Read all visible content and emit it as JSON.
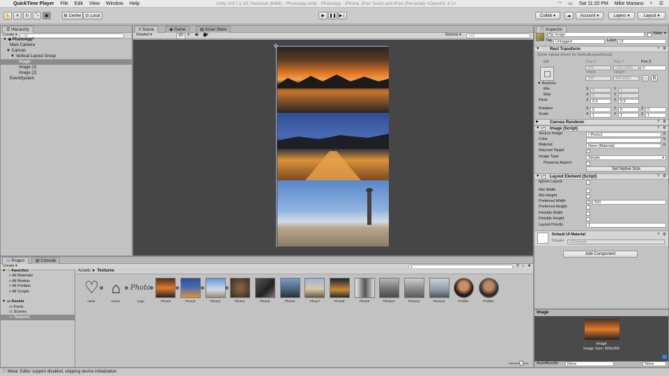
{
  "menubar": {
    "app": "QuickTime Player",
    "items": [
      "File",
      "Edit",
      "View",
      "Window",
      "Help"
    ],
    "window_title": "Unity 2017.1.1f1 Personal (64bit) - PhotoApp.unity - PhotoApp - iPhone, iPod Touch and iPad (Personal) <OpenGL 4.1>",
    "clock": "Sat 11:20 PM",
    "user": "Mike Mariano"
  },
  "toolbar": {
    "center": "Center",
    "local": "Local",
    "collab": "Collab",
    "account": "Account",
    "layers": "Layers",
    "layout": "Layout"
  },
  "hierarchy": {
    "tab": "Hierarchy",
    "create": "Create",
    "search_placeholder": "All",
    "items": [
      {
        "label": "PhotoApp*"
      },
      {
        "label": "Main Camera"
      },
      {
        "label": "Canvas"
      },
      {
        "label": "Vertical Layout Group"
      },
      {
        "label": "Image"
      },
      {
        "label": "Image (1)"
      },
      {
        "label": "Image (2)"
      },
      {
        "label": "EventSystem"
      }
    ]
  },
  "scene": {
    "tabs": [
      "Scene",
      "Game",
      "Asset Store"
    ],
    "shading": "Shaded",
    "mode_2d": "2D",
    "gizmos": "Gizmos",
    "search_placeholder": "All"
  },
  "inspector": {
    "tab": "Inspector",
    "object_name": "Image",
    "static_label": "Static",
    "tag_label": "Tag",
    "tag_value": "Untagged",
    "layer_label": "Layer",
    "layer_value": "UI",
    "rect_transform": {
      "title": "Rect Transform",
      "note": "Some values driven by VerticalLayoutGroup.",
      "anchor_preset": "left",
      "pos_x_label": "Pos X",
      "pos_x": "375",
      "pos_y_label": "Pos Y",
      "pos_y": "-222.3333",
      "pos_z_label": "Pos Z",
      "pos_z": "0",
      "width_label": "Width",
      "width": "750",
      "height_label": "Height",
      "height": "444.6667",
      "anchors": "Anchors",
      "min": "Min",
      "min_x": "0",
      "min_y": "1",
      "max": "Max",
      "max_x": "0",
      "max_y": "1",
      "pivot": "Pivot",
      "pivot_x": "0.5",
      "pivot_y": "0.5",
      "rotation": "Rotation",
      "rot_x": "0",
      "rot_y": "0",
      "rot_z": "0",
      "scale": "Scale",
      "scale_x": "1",
      "scale_y": "1",
      "scale_z": "1",
      "r_button": "R"
    },
    "canvas_renderer": "Canvas Renderer",
    "image_script": {
      "title": "Image (Script)",
      "source_image_label": "Source Image",
      "source_image": "Photo1",
      "color_label": "Color",
      "material_label": "Material",
      "material": "None (Material)",
      "raycast_label": "Raycast Target",
      "image_type_label": "Image Type",
      "image_type": "Simple",
      "preserve_label": "Preserve Aspect",
      "set_native": "Set Native Size"
    },
    "layout_element": {
      "title": "Layout Element (Script)",
      "ignore": "Ignore Layout",
      "min_width": "Min Width",
      "min_height": "Min Height",
      "pref_width": "Preferred Width",
      "pref_width_value": "500",
      "pref_height": "Preferred Height",
      "flex_width": "Flexible Width",
      "flex_height": "Flexible Height",
      "priority": "Layout Priority",
      "priority_value": "1"
    },
    "material": {
      "name": "Default UI Material",
      "shader_label": "Shader",
      "shader": "UI/Default"
    },
    "add_component": "Add Component"
  },
  "project": {
    "tabs": [
      "Project",
      "Console"
    ],
    "create": "Create",
    "favorites_title": "Favorites",
    "favorites": [
      "All Materials",
      "All Models",
      "All Prefabs",
      "All Scripts"
    ],
    "assets_title": "Assets",
    "assets": [
      "Fonts",
      "Scenes",
      "Textures"
    ],
    "breadcrumb_root": "Assets",
    "breadcrumb_sep": "►",
    "breadcrumb_leaf": "Textures",
    "textures": [
      "Heart",
      "Home",
      "Logo",
      "Photo1",
      "Photo2",
      "Photo3",
      "Photo4",
      "Photo5",
      "Photo6",
      "Photo7",
      "Photo8",
      "Photo9",
      "Photo10",
      "Photo11",
      "Photo12",
      "Profile1",
      "Profile2"
    ]
  },
  "preview": {
    "title": "Image",
    "caption_name": "Image",
    "caption_size": "Image Size: 500x300",
    "asset_bundle": "AssetBundle",
    "none1": "None",
    "none2": "None"
  },
  "status": "Metal: Editor support disabled, skipping device initialization",
  "colors": {
    "scene_bg": "#464646",
    "panel_bg": "#c2c2c2",
    "selection": "#8c8c8c",
    "accent_blue": "#3b7fd8"
  }
}
